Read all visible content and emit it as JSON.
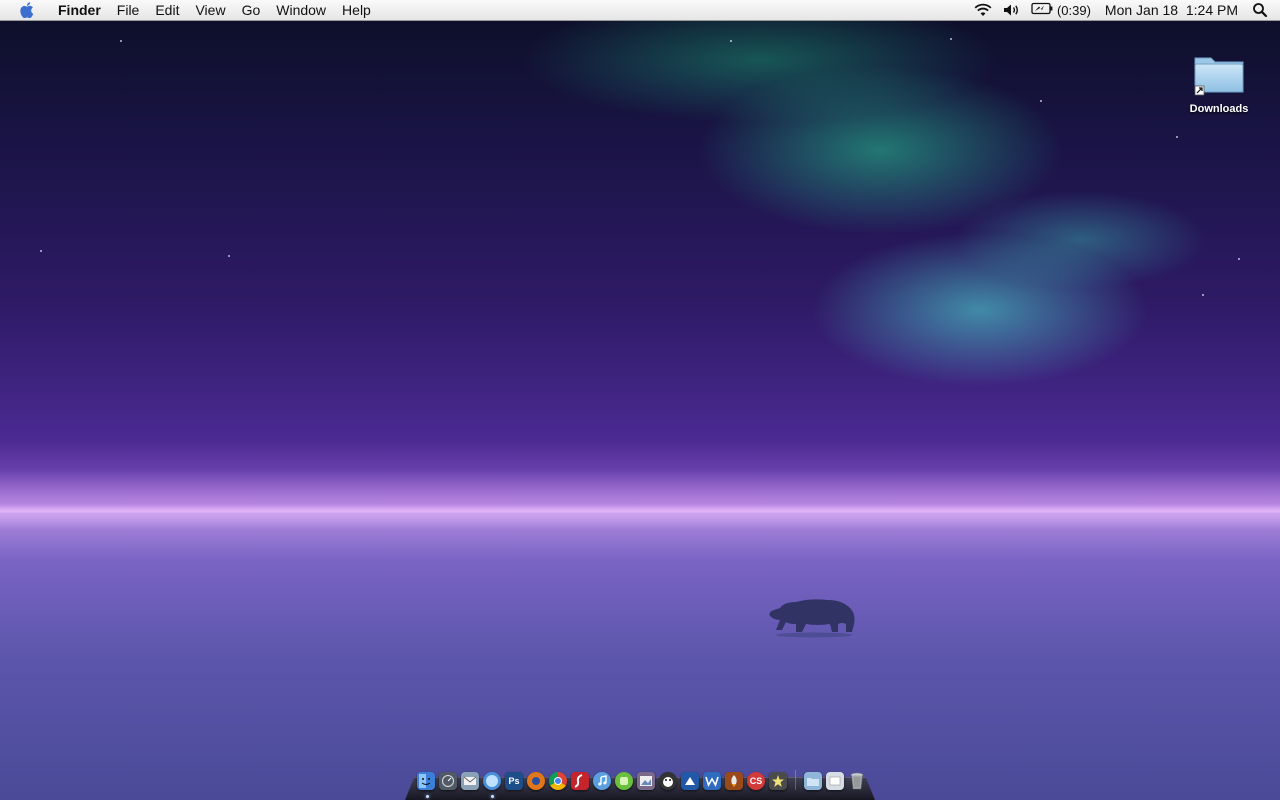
{
  "menubar": {
    "apple_icon": "apple-logo-icon",
    "app_name": "Finder",
    "menus": [
      "File",
      "Edit",
      "View",
      "Go",
      "Window",
      "Help"
    ],
    "status": {
      "wifi_icon": "wifi-icon",
      "volume_icon": "volume-icon",
      "battery_icon": "battery-charging-icon",
      "battery_time": "(0:39)",
      "clock": "Mon Jan 18  1:24 PM",
      "spotlight_icon": "spotlight-search-icon"
    }
  },
  "desktop": {
    "wallpaper": "aurora-polar-bear",
    "icons": [
      {
        "label": "Downloads",
        "icon": "folder-alias-icon"
      }
    ]
  },
  "dock": {
    "apps": [
      {
        "name": "Finder",
        "icon": "finder-icon",
        "color": "#3c7fd9"
      },
      {
        "name": "Dashboard",
        "icon": "dashboard-icon",
        "color": "#505a66"
      },
      {
        "name": "Mail",
        "icon": "mail-icon",
        "color": "#8aa2b8"
      },
      {
        "name": "Safari",
        "icon": "safari-icon",
        "color": "#4a90d9"
      },
      {
        "name": "Photoshop",
        "icon": "photoshop-icon",
        "color": "#1c4e8a",
        "text": "Ps"
      },
      {
        "name": "Firefox",
        "icon": "firefox-icon",
        "color": "#e2761b"
      },
      {
        "name": "Chrome",
        "icon": "chrome-icon",
        "color": "#2ea44f"
      },
      {
        "name": "Flash",
        "icon": "flash-icon",
        "color": "#c4242b"
      },
      {
        "name": "iTunes",
        "icon": "itunes-icon",
        "color": "#5aa0e0"
      },
      {
        "name": "iChat",
        "icon": "ichat-icon",
        "color": "#6abf3d"
      },
      {
        "name": "Preview",
        "icon": "preview-icon",
        "color": "#7b6a8a"
      },
      {
        "name": "Camino",
        "icon": "camino-icon",
        "color": "#333333"
      },
      {
        "name": "Transmit",
        "icon": "transmit-icon",
        "color": "#2158a8"
      },
      {
        "name": "Word",
        "icon": "word-icon",
        "color": "#2f6bbf"
      },
      {
        "name": "Rocket",
        "icon": "rocket-icon",
        "color": "#9a4a1a"
      },
      {
        "name": "Creative Suite",
        "icon": "creative-suite-icon",
        "color": "#d33a3a",
        "text": "CS"
      },
      {
        "name": "iMovie",
        "icon": "imovie-icon",
        "color": "#4b4b4b"
      }
    ],
    "stacks": [
      {
        "name": "Applications",
        "icon": "applications-stack-icon",
        "color": "#8fb6d8"
      },
      {
        "name": "Documents",
        "icon": "documents-stack-icon",
        "color": "#d7dde4"
      }
    ],
    "trash": {
      "name": "Trash",
      "icon": "trash-icon",
      "color": "#a3a8ad"
    },
    "running": [
      "Finder",
      "Chrome"
    ]
  }
}
